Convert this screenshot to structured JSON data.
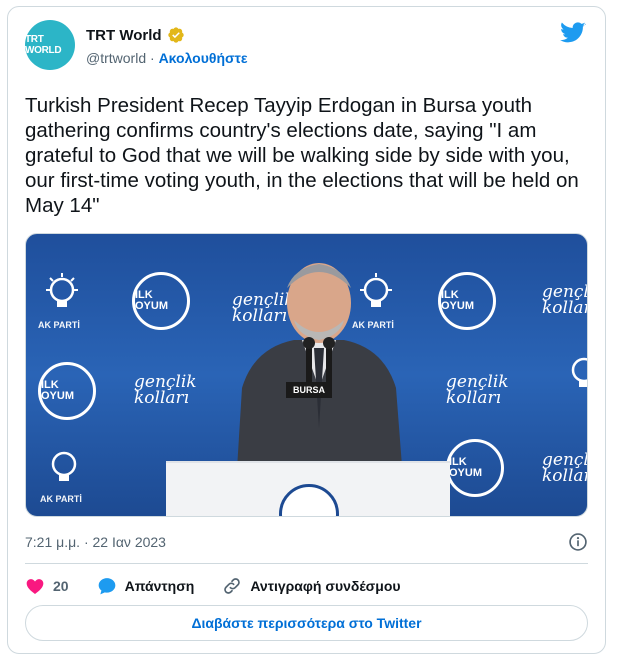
{
  "tweet": {
    "author_name": "TRT World",
    "avatar_text": "TRT WORLD",
    "handle": "@trtworld",
    "separator": " · ",
    "follow_label": "Ακολουθήστε",
    "text": "Turkish President Recep Tayyip Erdogan in Bursa youth gathering confirms country's elections date, saying \"I am grateful to God that we will be walking side by side with you, our first-time voting youth, in the elections that will be held on May 14\"",
    "timestamp": "7:21 μ.μ. · 22 Ιαν 2023",
    "likes_count": "20",
    "reply_label": "Απάντηση",
    "copy_link_label": "Αντιγραφή συνδέσμου",
    "read_more_label": "Διαβάστε περισσότερα στο Twitter"
  },
  "media": {
    "backdrop_logos": [
      "AK PARTİ",
      "İLK OYUM",
      "gençlik kolları"
    ],
    "podium_sign": "BURSA"
  },
  "colors": {
    "link": "#006fd6",
    "twitter_blue": "#1d9bf0",
    "like_pink": "#f91880",
    "verified_gold": "#e2b719",
    "avatar_teal": "#2cb5c7",
    "backdrop_blue": "#2a64b6"
  },
  "icons": [
    "verified-badge-icon",
    "twitter-bird-icon",
    "info-icon",
    "heart-icon",
    "reply-bubble-icon",
    "link-icon"
  ]
}
